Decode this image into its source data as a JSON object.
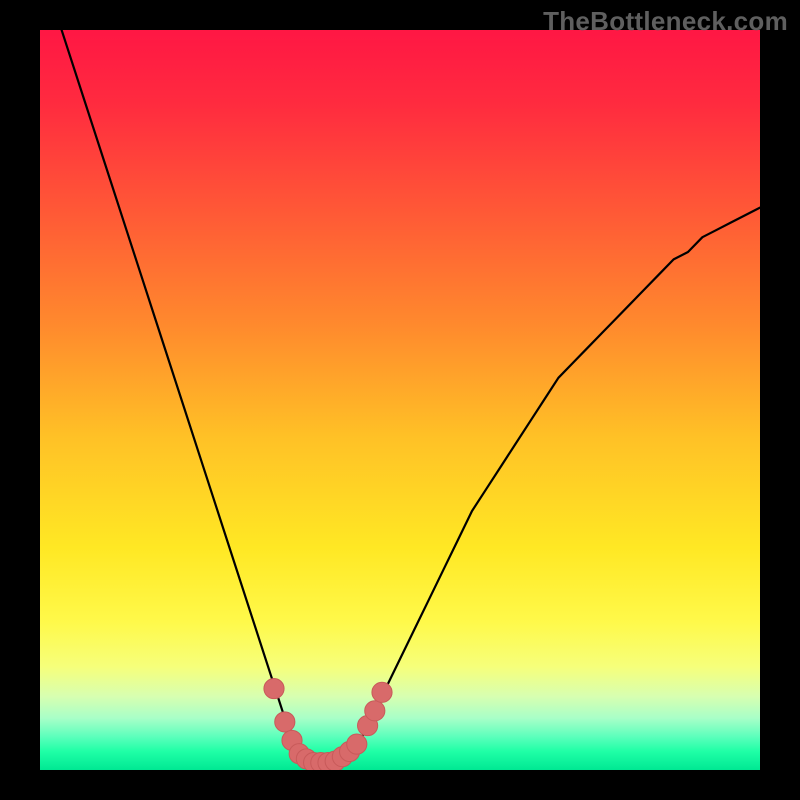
{
  "watermark": "TheBottleneck.com",
  "colors": {
    "gradient_stops": [
      {
        "offset": 0.0,
        "color": "#ff1744"
      },
      {
        "offset": 0.1,
        "color": "#ff2b3f"
      },
      {
        "offset": 0.25,
        "color": "#ff5a36"
      },
      {
        "offset": 0.4,
        "color": "#ff8a2d"
      },
      {
        "offset": 0.55,
        "color": "#ffc126"
      },
      {
        "offset": 0.7,
        "color": "#ffe824"
      },
      {
        "offset": 0.8,
        "color": "#fff94a"
      },
      {
        "offset": 0.86,
        "color": "#f6ff7a"
      },
      {
        "offset": 0.9,
        "color": "#d8ffb0"
      },
      {
        "offset": 0.93,
        "color": "#a8ffc8"
      },
      {
        "offset": 0.955,
        "color": "#5cffbc"
      },
      {
        "offset": 0.975,
        "color": "#1fffa6"
      },
      {
        "offset": 1.0,
        "color": "#00e893"
      }
    ],
    "curve": "#000000",
    "marker_fill": "#d86a6a",
    "marker_stroke": "#c85a5a",
    "frame": "#000000"
  },
  "chart_data": {
    "type": "line",
    "title": "",
    "xlabel": "",
    "ylabel": "",
    "xlim": [
      0,
      100
    ],
    "ylim": [
      0,
      100
    ],
    "grid": false,
    "series": [
      {
        "name": "bottleneck-curve",
        "x": [
          0,
          2,
          4,
          6,
          8,
          10,
          12,
          14,
          16,
          18,
          20,
          22,
          24,
          26,
          28,
          30,
          31,
          32,
          33,
          34,
          35,
          36,
          37,
          38,
          39,
          40,
          41,
          42,
          43,
          44,
          45,
          46,
          48,
          50,
          52,
          54,
          56,
          58,
          60,
          62,
          64,
          66,
          68,
          70,
          72,
          74,
          76,
          78,
          80,
          82,
          84,
          86,
          88,
          90,
          92,
          94,
          96,
          98,
          100
        ],
        "values": [
          109,
          103,
          97,
          91,
          85,
          79,
          73,
          67,
          61,
          55,
          49,
          43,
          37,
          31,
          25,
          19,
          16,
          13,
          10,
          7,
          5,
          3,
          2,
          1,
          1,
          1,
          1,
          1,
          2,
          3,
          5,
          7,
          11,
          15,
          19,
          23,
          27,
          31,
          35,
          38,
          41,
          44,
          47,
          50,
          53,
          55,
          57,
          59,
          61,
          63,
          65,
          67,
          69,
          70,
          72,
          73,
          74,
          75,
          76
        ]
      }
    ],
    "markers": [
      {
        "x": 32.5,
        "y": 11
      },
      {
        "x": 34.0,
        "y": 6.5
      },
      {
        "x": 35.0,
        "y": 4.0
      },
      {
        "x": 36.0,
        "y": 2.2
      },
      {
        "x": 37.0,
        "y": 1.5
      },
      {
        "x": 38.0,
        "y": 1.0
      },
      {
        "x": 39.0,
        "y": 1.0
      },
      {
        "x": 40.0,
        "y": 1.0
      },
      {
        "x": 41.0,
        "y": 1.2
      },
      {
        "x": 42.0,
        "y": 1.8
      },
      {
        "x": 43.0,
        "y": 2.5
      },
      {
        "x": 44.0,
        "y": 3.5
      },
      {
        "x": 45.5,
        "y": 6.0
      },
      {
        "x": 46.5,
        "y": 8.0
      },
      {
        "x": 47.5,
        "y": 10.5
      }
    ],
    "marker_radius_pct": 1.4
  }
}
